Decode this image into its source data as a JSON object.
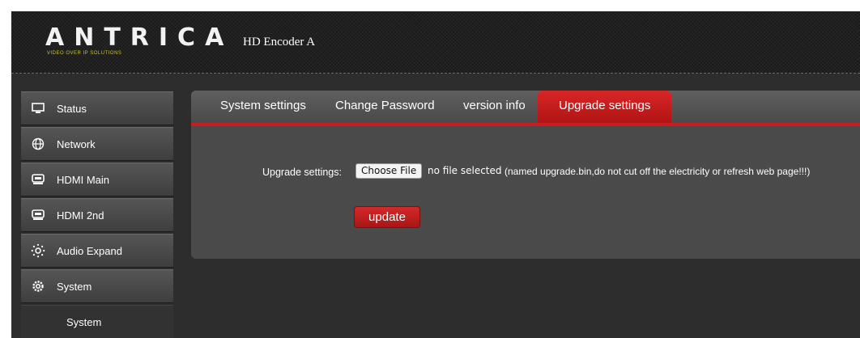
{
  "header": {
    "logo_text": "ANTRICA",
    "logo_tagline": "VIDEO OVER IP SOLUTIONS",
    "device_name": "HD Encoder  A"
  },
  "sidebar": {
    "items": [
      {
        "label": "Status",
        "icon": "monitor-icon"
      },
      {
        "label": "Network",
        "icon": "globe-icon"
      },
      {
        "label": "HDMI Main",
        "icon": "hdmi-icon"
      },
      {
        "label": "HDMI 2nd",
        "icon": "hdmi-icon"
      },
      {
        "label": "Audio Expand",
        "icon": "audio-dots-icon"
      },
      {
        "label": "System",
        "icon": "gear-icon"
      }
    ],
    "subitem": "System"
  },
  "tabs": [
    {
      "label": "System settings"
    },
    {
      "label": "Change Password"
    },
    {
      "label": "version info"
    },
    {
      "label": "Upgrade settings",
      "active": true
    }
  ],
  "upgrade": {
    "label": "Upgrade settings:",
    "choose_button": "Choose File",
    "file_status": "no file selected",
    "hint": "(named upgrade.bin,do not cut off the electricity or refresh web page!!!)",
    "update_button": "update"
  },
  "colors": {
    "accent": "#c81e1e",
    "panel": "#4a4a4a",
    "background": "#2d2d2d"
  }
}
